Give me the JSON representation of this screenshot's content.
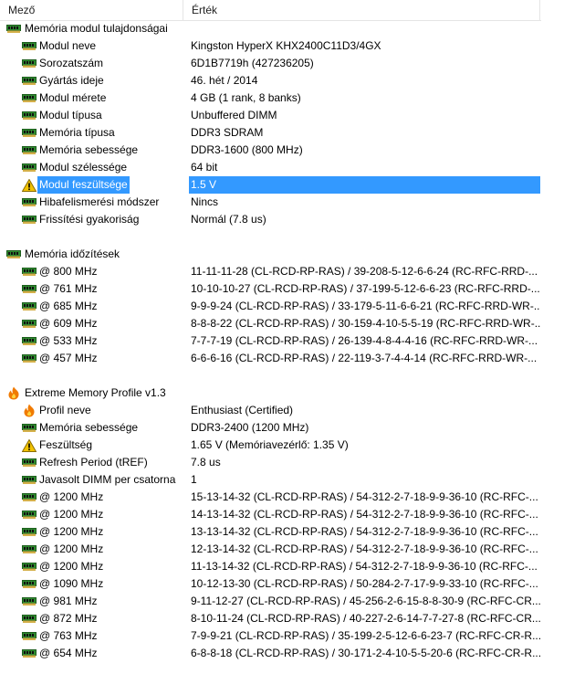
{
  "header": {
    "field": "Mező",
    "value": "Érték"
  },
  "colors": {
    "selection": "#3399ff",
    "ram_chip": "#2f8a2f",
    "warning": "#f2c200",
    "flame": "#f07a00"
  },
  "sections": [
    {
      "title": "Memória modul tulajdonságai",
      "icon": "ram-icon",
      "rows": [
        {
          "label": "Modul neve",
          "value": "Kingston HyperX KHX2400C11D3/4GX",
          "icon": "ram-icon"
        },
        {
          "label": "Sorozatszám",
          "value": "6D1B7719h (427236205)",
          "icon": "ram-icon"
        },
        {
          "label": "Gyártás ideje",
          "value": "46. hét / 2014",
          "icon": "ram-icon"
        },
        {
          "label": "Modul mérete",
          "value": "4 GB (1 rank, 8 banks)",
          "icon": "ram-icon"
        },
        {
          "label": "Modul típusa",
          "value": "Unbuffered DIMM",
          "icon": "ram-icon"
        },
        {
          "label": "Memória típusa",
          "value": "DDR3 SDRAM",
          "icon": "ram-icon"
        },
        {
          "label": "Memória sebessége",
          "value": "DDR3-1600 (800 MHz)",
          "icon": "ram-icon"
        },
        {
          "label": "Modul szélessége",
          "value": "64 bit",
          "icon": "ram-icon"
        },
        {
          "label": "Modul feszültsége",
          "value": "1.5 V",
          "icon": "voltage-warning-icon",
          "selected": true
        },
        {
          "label": "Hibafelismerési módszer",
          "value": "Nincs",
          "icon": "ram-icon"
        },
        {
          "label": "Frissítési gyakoriság",
          "value": "Normál (7.8 us)",
          "icon": "ram-icon"
        }
      ]
    },
    {
      "title": "Memória időzítések",
      "icon": "ram-icon",
      "rows": [
        {
          "label": "@ 800 MHz",
          "value": "11-11-11-28  (CL-RCD-RP-RAS) / 39-208-5-12-6-6-24  (RC-RFC-RRD-...",
          "icon": "ram-icon"
        },
        {
          "label": "@ 761 MHz",
          "value": "10-10-10-27  (CL-RCD-RP-RAS) / 37-199-5-12-6-6-23  (RC-RFC-RRD-...",
          "icon": "ram-icon"
        },
        {
          "label": "@ 685 MHz",
          "value": "9-9-9-24  (CL-RCD-RP-RAS) / 33-179-5-11-6-6-21  (RC-RFC-RRD-WR-...",
          "icon": "ram-icon"
        },
        {
          "label": "@ 609 MHz",
          "value": "8-8-8-22  (CL-RCD-RP-RAS) / 30-159-4-10-5-5-19  (RC-RFC-RRD-WR-...",
          "icon": "ram-icon"
        },
        {
          "label": "@ 533 MHz",
          "value": "7-7-7-19  (CL-RCD-RP-RAS) / 26-139-4-8-4-4-16  (RC-RFC-RRD-WR-...",
          "icon": "ram-icon"
        },
        {
          "label": "@ 457 MHz",
          "value": "6-6-6-16  (CL-RCD-RP-RAS) / 22-119-3-7-4-4-14  (RC-RFC-RRD-WR-...",
          "icon": "ram-icon"
        }
      ]
    },
    {
      "title": "Extreme Memory Profile v1.3",
      "icon": "xmp-flame-icon",
      "rows": [
        {
          "label": "Profil neve",
          "value": "Enthusiast (Certified)",
          "icon": "xmp-flame-icon"
        },
        {
          "label": "Memória sebessége",
          "value": "DDR3-2400 (1200 MHz)",
          "icon": "ram-icon"
        },
        {
          "label": "Feszültség",
          "value": "1.65 V  (Memóriavezérlő: 1.35 V)",
          "icon": "voltage-warning-icon"
        },
        {
          "label": "Refresh Period (tREF)",
          "value": "7.8 us",
          "icon": "ram-icon"
        },
        {
          "label": "Javasolt DIMM per csatorna",
          "value": "1",
          "icon": "ram-icon"
        },
        {
          "label": "@ 1200 MHz",
          "value": "15-13-14-32  (CL-RCD-RP-RAS) / 54-312-2-7-18-9-9-36-10  (RC-RFC-...",
          "icon": "ram-icon"
        },
        {
          "label": "@ 1200 MHz",
          "value": "14-13-14-32  (CL-RCD-RP-RAS) / 54-312-2-7-18-9-9-36-10  (RC-RFC-...",
          "icon": "ram-icon"
        },
        {
          "label": "@ 1200 MHz",
          "value": "13-13-14-32  (CL-RCD-RP-RAS) / 54-312-2-7-18-9-9-36-10  (RC-RFC-...",
          "icon": "ram-icon"
        },
        {
          "label": "@ 1200 MHz",
          "value": "12-13-14-32  (CL-RCD-RP-RAS) / 54-312-2-7-18-9-9-36-10  (RC-RFC-...",
          "icon": "ram-icon"
        },
        {
          "label": "@ 1200 MHz",
          "value": "11-13-14-32  (CL-RCD-RP-RAS) / 54-312-2-7-18-9-9-36-10  (RC-RFC-...",
          "icon": "ram-icon"
        },
        {
          "label": "@ 1090 MHz",
          "value": "10-12-13-30  (CL-RCD-RP-RAS) / 50-284-2-7-17-9-9-33-10  (RC-RFC-...",
          "icon": "ram-icon"
        },
        {
          "label": "@ 981 MHz",
          "value": "9-11-12-27  (CL-RCD-RP-RAS) / 45-256-2-6-15-8-8-30-9  (RC-RFC-CR...",
          "icon": "ram-icon"
        },
        {
          "label": "@ 872 MHz",
          "value": "8-10-11-24  (CL-RCD-RP-RAS) / 40-227-2-6-14-7-7-27-8  (RC-RFC-CR...",
          "icon": "ram-icon"
        },
        {
          "label": "@ 763 MHz",
          "value": "7-9-9-21  (CL-RCD-RP-RAS) / 35-199-2-5-12-6-6-23-7  (RC-RFC-CR-R...",
          "icon": "ram-icon"
        },
        {
          "label": "@ 654 MHz",
          "value": "6-8-8-18  (CL-RCD-RP-RAS) / 30-171-2-4-10-5-5-20-6  (RC-RFC-CR-R...",
          "icon": "ram-icon"
        }
      ]
    }
  ]
}
